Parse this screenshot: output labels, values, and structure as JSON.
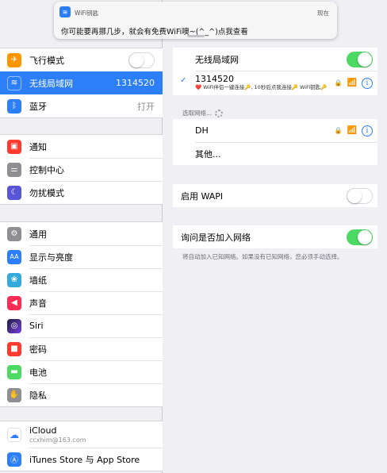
{
  "banner": {
    "app_name": "WiFi钥匙",
    "time": "现在",
    "message": "你可能要再挪几步，就会有免费WiFi噢~(^_^)点我查看"
  },
  "sidebar": {
    "group1": [
      {
        "label": "飞行模式",
        "icon": "airplane-icon",
        "color": "#ff9500",
        "glyph": "✈"
      },
      {
        "label": "无线局域网",
        "value": "1314520",
        "icon": "wifi-icon",
        "color": "#2d7ff9",
        "glyph": "≋"
      },
      {
        "label": "蓝牙",
        "value": "打开",
        "icon": "bluetooth-icon",
        "color": "#2d7ff9",
        "glyph": "ᛒ"
      }
    ],
    "group2": [
      {
        "label": "通知",
        "icon": "notifications-icon",
        "color": "#ff3b30",
        "glyph": "▣"
      },
      {
        "label": "控制中心",
        "icon": "control-center-icon",
        "color": "#8e8e93",
        "glyph": "⚌"
      },
      {
        "label": "勿扰模式",
        "icon": "moon-icon",
        "color": "#5856d6",
        "glyph": "☾"
      }
    ],
    "group3": [
      {
        "label": "通用",
        "icon": "gear-icon",
        "color": "#8e8e93",
        "glyph": "⚙"
      },
      {
        "label": "显示与亮度",
        "icon": "display-icon",
        "color": "#2d7ff9",
        "glyph": "AA"
      },
      {
        "label": "墙纸",
        "icon": "wallpaper-icon",
        "color": "#34aadc",
        "glyph": "❀"
      },
      {
        "label": "声音",
        "icon": "sound-icon",
        "color": "#ff2d55",
        "glyph": "◀"
      },
      {
        "label": "Siri",
        "icon": "siri-icon",
        "color": "#1c1c3c",
        "glyph": "◎"
      },
      {
        "label": "密码",
        "icon": "lock-icon",
        "color": "#ff3b30",
        "glyph": "■"
      },
      {
        "label": "电池",
        "icon": "battery-icon",
        "color": "#4cd964",
        "glyph": "▬"
      },
      {
        "label": "隐私",
        "icon": "hand-icon",
        "color": "#8e8e93",
        "glyph": "✋"
      }
    ],
    "group4": [
      {
        "label": "iCloud",
        "sublabel": "ccxhim@163.com",
        "icon": "icloud-icon",
        "color": "#ffffff",
        "glyph": "☁"
      },
      {
        "label": "iTunes Store 与 App Store",
        "icon": "app-store-icon",
        "color": "#2d7ff9",
        "glyph": "Ⓐ"
      }
    ]
  },
  "main": {
    "wifi_label": "无线局域网",
    "connected_network": "1314520",
    "connected_caption": "❤️ WiFi伴侣一键连接🔑, 10秒后点我连接🔑 WiFi钥匙🔑",
    "choose_network_header": "选取网络...",
    "networks": [
      "DH"
    ],
    "other_label": "其他...",
    "wapi_label": "启用 WAPI",
    "ask_join_label": "询问是否加入网络",
    "ask_join_footnote": "将自动加入已知网络。如果没有已知网络，您必须手动选择。"
  },
  "colors": {
    "accent": "#2d7ff9",
    "toggle_on": "#4cd964",
    "background": "#efeff4"
  }
}
